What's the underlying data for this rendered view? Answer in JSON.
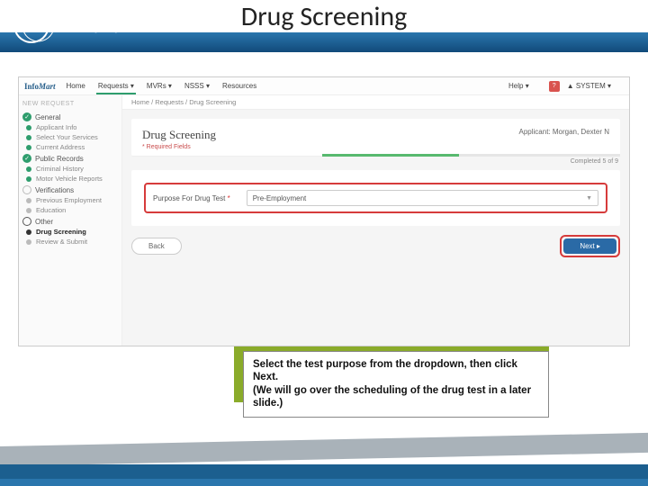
{
  "slide": {
    "title": "Drug Screening"
  },
  "logo": {
    "part1": "Info",
    "part2": "Mart",
    "tm": "®"
  },
  "topnav": {
    "items": [
      "Home",
      "Requests ▾",
      "MVRs ▾",
      "NSSS ▾",
      "Resources"
    ],
    "help": "Help ▾",
    "badge": "?",
    "user": "▲ SYSTEM ▾"
  },
  "sidebar": {
    "header": "NEW REQUEST",
    "groups": [
      {
        "label": "General",
        "done": true,
        "items": [
          {
            "label": "Applicant Info",
            "dot": "green"
          },
          {
            "label": "Select Your Services",
            "dot": "green"
          },
          {
            "label": "Current Address",
            "dot": "green"
          }
        ]
      },
      {
        "label": "Public Records",
        "done": true,
        "items": [
          {
            "label": "Criminal History",
            "dot": "green"
          },
          {
            "label": "Motor Vehicle Reports",
            "dot": "green"
          }
        ]
      },
      {
        "label": "Verifications",
        "done": false,
        "items": [
          {
            "label": "Previous Employment",
            "dot": "grey"
          },
          {
            "label": "Education",
            "dot": "grey"
          }
        ]
      },
      {
        "label": "Other",
        "done": false,
        "open": true,
        "items": [
          {
            "label": "Drug Screening",
            "dot": "dark",
            "active": true
          },
          {
            "label": "Review & Submit",
            "dot": "grey"
          }
        ]
      }
    ]
  },
  "breadcrumb": "Home  /  Requests  /  Drug Screening",
  "page": {
    "title": "Drug Screening",
    "required": "* Required Fields",
    "applicant": "Applicant: Morgan, Dexter N",
    "progress_text": "Completed 5 of 9"
  },
  "form": {
    "purpose_label": "Purpose For Drug Test",
    "purpose_ast": "*",
    "purpose_value": "Pre-Employment"
  },
  "buttons": {
    "back": "Back",
    "next": "Next ▸"
  },
  "caption": {
    "line1": "Select the test purpose from the dropdown, then click Next.",
    "line2": "(We will go over the scheduling of the drug test in a later slide.)"
  }
}
